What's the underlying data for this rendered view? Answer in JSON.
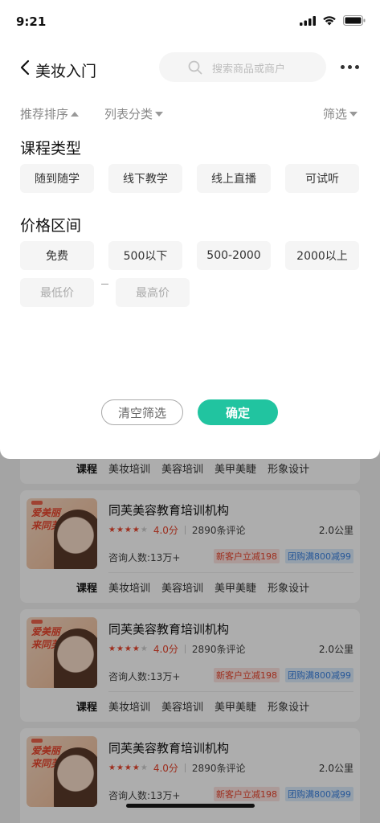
{
  "status": {
    "time": "9:21"
  },
  "nav": {
    "title": "美妆入门",
    "search_placeholder": "搜索商品或商户"
  },
  "sort": {
    "recommend": "推荐排序",
    "category": "列表分类",
    "filter": "筛选"
  },
  "course_type": {
    "title": "课程类型",
    "options": [
      "随到随学",
      "线下教学",
      "线上直播",
      "可试听"
    ]
  },
  "price": {
    "title": "价格区间",
    "options": [
      "免费",
      "500以下",
      "500-2000",
      "2000以上"
    ],
    "min_placeholder": "最低价",
    "max_placeholder": "最高价"
  },
  "buttons": {
    "clear": "清空筛选",
    "confirm": "确定"
  },
  "tag_row": [
    "课程",
    "美妆培训",
    "美容培训",
    "美甲美睫",
    "形象设计"
  ],
  "cards": [
    {
      "thumb_text_1": "爱美丽",
      "thumb_text_2": "来同芙",
      "name": "同芙美容教育培训机构",
      "rating": 4,
      "score": "4.0分",
      "reviews": "2890条评论",
      "distance": "2.0公里",
      "consult": "咨询人数:13万+",
      "promo_1": "新客户立减198",
      "promo_2": "团购满800减99"
    },
    {
      "thumb_text_1": "爱美丽",
      "thumb_text_2": "来同芙",
      "name": "同芙美容教育培训机构",
      "rating": 4,
      "score": "4.0分",
      "reviews": "2890条评论",
      "distance": "2.0公里",
      "consult": "咨询人数:13万+",
      "promo_1": "新客户立减198",
      "promo_2": "团购满800减99"
    },
    {
      "thumb_text_1": "爱美丽",
      "thumb_text_2": "来同芙",
      "name": "同芙美容教育培训机构",
      "rating": 4,
      "score": "4.0分",
      "reviews": "2890条评论",
      "distance": "2.0公里",
      "consult": "咨询人数:13万+",
      "promo_1": "新客户立减198",
      "promo_2": "团购满800减99"
    }
  ],
  "colors": {
    "accent": "#21c4a0",
    "price_red": "#e8452d",
    "promo_blue": "#3b82e0"
  }
}
